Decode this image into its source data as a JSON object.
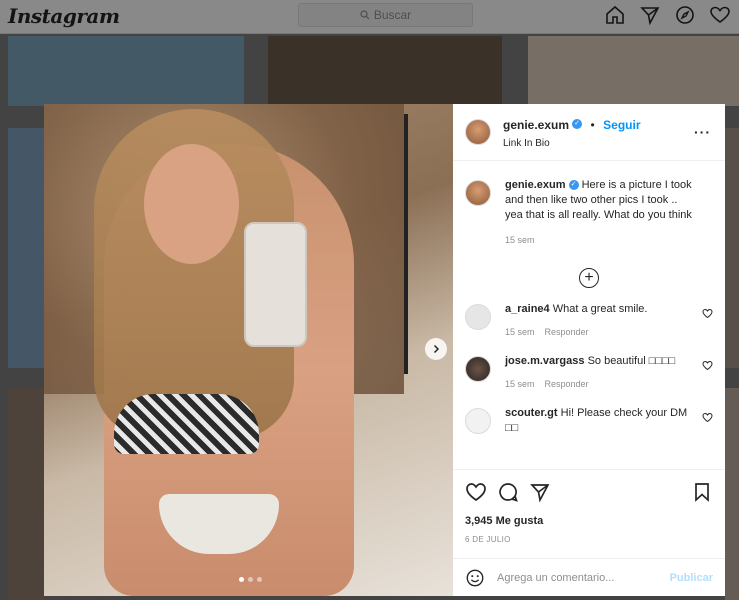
{
  "nav": {
    "logo": "Instagram",
    "search_placeholder": "Buscar",
    "icons": [
      "home-icon",
      "direct-icon",
      "explore-icon",
      "activity-heart-icon"
    ]
  },
  "post": {
    "author": {
      "username": "genie.exum",
      "verified": true,
      "follow_label": "Seguir",
      "subtitle": "Link In Bio"
    },
    "caption": {
      "username": "genie.exum",
      "text": "Here is a picture I took and then like two other pics I took .. yea that is all really. What do you think",
      "time": "15 sem"
    },
    "comments": [
      {
        "username": "a_raine4",
        "text": "What a great smile.",
        "time": "15 sem",
        "reply_label": "Responder"
      },
      {
        "username": "jose.m.vargass",
        "text": "So beautiful □□□□",
        "time": "15 sem",
        "reply_label": "Responder"
      },
      {
        "username": "scouter.gt",
        "text": "Hi! Please check your DM □□",
        "time": "",
        "reply_label": ""
      }
    ],
    "likes": "3,945 Me gusta",
    "date": "6 DE JULIO",
    "carousel": {
      "count": 3,
      "active": 0
    },
    "add_comment": {
      "placeholder": "Agrega un comentario...",
      "post_label": "Publicar"
    }
  }
}
